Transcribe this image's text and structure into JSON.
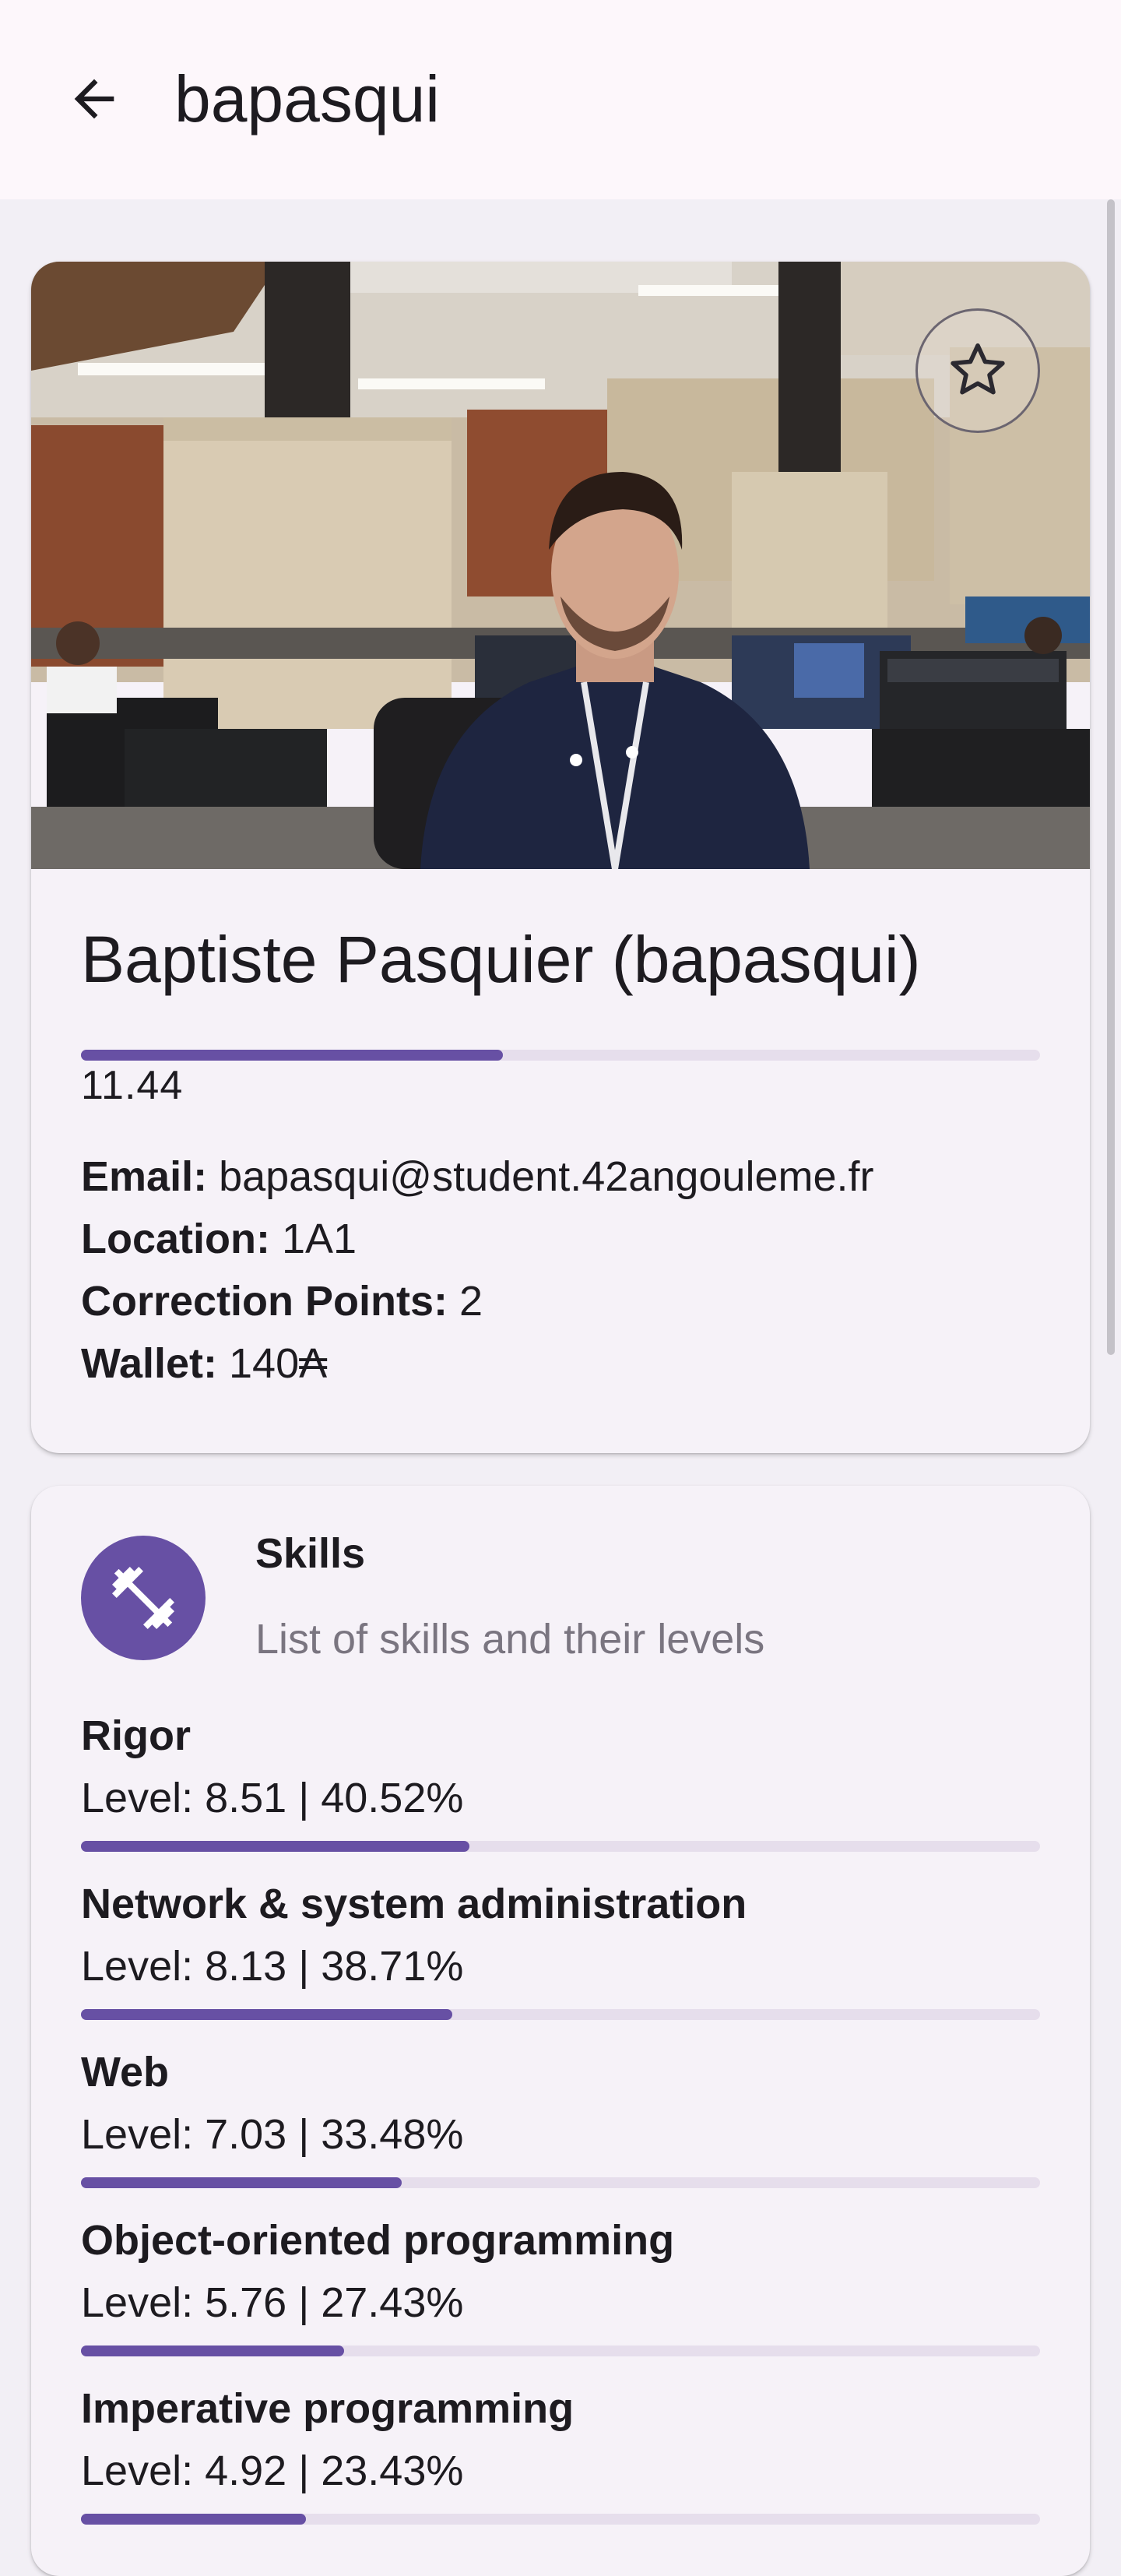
{
  "appbar": {
    "title": "bapasqui",
    "back_icon": "arrow-back-icon"
  },
  "profile": {
    "favorite_icon": "star-outline-icon",
    "name": "Baptiste Pasquier (bapasqui)",
    "level": "11.44",
    "level_progress": 0.44,
    "email_label": "Email:",
    "email": "bapasqui@student.42angouleme.fr",
    "location_label": "Location:",
    "location": "1A1",
    "correction_label": "Correction Points:",
    "correction_points": "2",
    "wallet_label": "Wallet:",
    "wallet": "140₳"
  },
  "skills": {
    "icon": "fitness-dumbbell-icon",
    "title": "Skills",
    "subtitle": "List of skills and their levels",
    "items": [
      {
        "name": "Rigor",
        "level_text": "Level: 8.51 | 40.52%",
        "progress": 0.4052
      },
      {
        "name": "Network & system administration",
        "level_text": "Level: 8.13 | 38.71%",
        "progress": 0.3871
      },
      {
        "name": "Web",
        "level_text": "Level: 7.03 | 33.48%",
        "progress": 0.3348
      },
      {
        "name": "Object-oriented programming",
        "level_text": "Level: 5.76 | 27.43%",
        "progress": 0.2743
      },
      {
        "name": "Imperative programming",
        "level_text": "Level: 4.92 | 23.43%",
        "progress": 0.2343
      }
    ]
  },
  "colors": {
    "accent": "#6750a4",
    "track": "#e6deec",
    "surface": "#f6f2f8",
    "background": "#f2eff5"
  }
}
